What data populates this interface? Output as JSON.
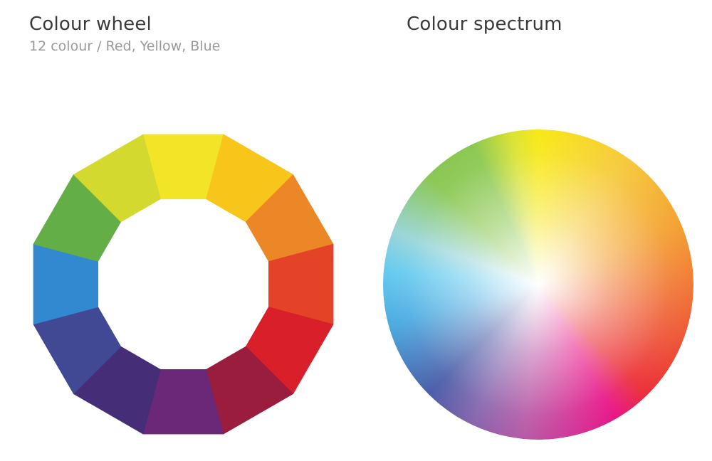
{
  "wheel": {
    "title": "Colour wheel",
    "subtitle": "12 colour / Red, Yellow, Blue",
    "segments": [
      {
        "name": "yellow",
        "color": "#f2e528"
      },
      {
        "name": "yellow-orange",
        "color": "#f8c51a"
      },
      {
        "name": "orange",
        "color": "#ec8728"
      },
      {
        "name": "red-orange",
        "color": "#e44327"
      },
      {
        "name": "red",
        "color": "#d81f2a"
      },
      {
        "name": "red-violet",
        "color": "#9b1d3e"
      },
      {
        "name": "violet",
        "color": "#6b2778"
      },
      {
        "name": "blue-violet",
        "color": "#452d78"
      },
      {
        "name": "blue",
        "color": "#414894"
      },
      {
        "name": "blue-green",
        "color": "#3389cf"
      },
      {
        "name": "green",
        "color": "#63ae47"
      },
      {
        "name": "yellow-green",
        "color": "#d3d92e"
      }
    ]
  },
  "spectrum": {
    "title": "Colour spectrum"
  }
}
